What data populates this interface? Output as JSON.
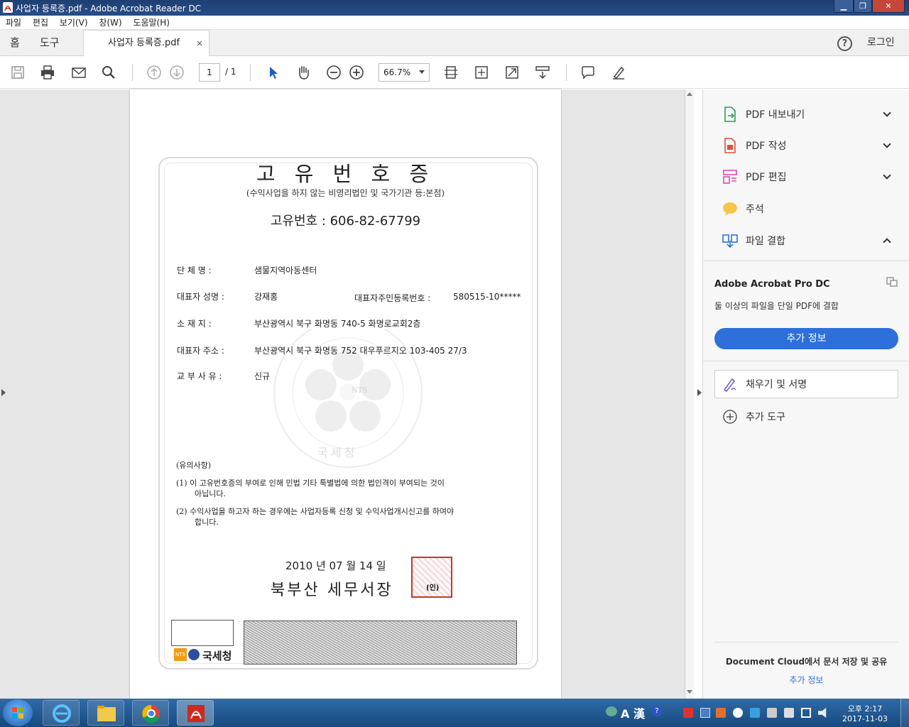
{
  "window": {
    "title": "사업자 등록증.pdf - Adobe Acrobat Reader DC",
    "minimize": "▁",
    "maximize": "❐",
    "close": "✕"
  },
  "menu": [
    "파일",
    "편집",
    "보기(V)",
    "창(W)",
    "도움말(H)"
  ],
  "tabs": {
    "home": "홈",
    "tools": "도구",
    "document": "사업자 등록증.pdf",
    "close": "×",
    "help": "?",
    "login": "로그인"
  },
  "toolbar": {
    "page_current": "1",
    "page_total": "/ 1",
    "zoom": "66.7%",
    "icons": [
      "save-icon",
      "print-icon",
      "email-icon",
      "search-icon",
      "page-up-icon",
      "page-down-icon",
      "select-arrow-icon",
      "hand-tool-icon",
      "zoom-out-icon",
      "zoom-in-icon",
      "fit-width-icon",
      "fit-page-icon",
      "fullscreen-icon",
      "scroll-mode-icon",
      "comment-icon",
      "highlight-pen-icon"
    ]
  },
  "document": {
    "title": "고 유 번 호 증",
    "subtitle": "(수익사업을 하지 않는 비영리법인 및 국가기관 등:본점)",
    "number_line": "고유번호 : 606-82-67799",
    "fields": [
      {
        "label": "단    체    명 :",
        "value": "샘물지역아동센터"
      },
      {
        "label": "대표자  성명 :",
        "value": "강재홍"
      },
      {
        "label": "소    재    지 :",
        "value": "부산광역시  북구  화명동 740-5 화명로교회2층"
      },
      {
        "label": "대표자  주소 :",
        "value": "부산광역시  북구  화명동 752  대우푸르지오  103-405 27/3"
      },
      {
        "label": "교  부  사  유 :",
        "value": "신규"
      }
    ],
    "resident_label": "대표자주민등록번호 :",
    "resident_value": "580515-10*****",
    "notes_heading": "(유의사항)",
    "note1": "(1) 이 고유번호증의 부여로 인해 민법 기타 특별법에 의한 법인격이 부여되는 것이",
    "note1b": "아닙니다.",
    "note2": "(2) 수익사업을 하고자 하는 경우에는 사업자등록 신청 및 수익사업개시신고를 하여야",
    "note2b": "합니다.",
    "date_line": "2010 년   07 월   14 일",
    "issuer": "북부산 세무서장",
    "seal_mark": "(인)",
    "agency_logo": "국세청",
    "agency_badge": "NTS",
    "watermark_agency": "국세청",
    "watermark_badge": "NTS"
  },
  "right_pane": {
    "tools": [
      {
        "label": "PDF 내보내기",
        "icon": "export-pdf-icon"
      },
      {
        "label": "PDF 작성",
        "icon": "create-pdf-icon"
      },
      {
        "label": "PDF 편집",
        "icon": "edit-pdf-icon"
      },
      {
        "label": "주석",
        "icon": "comment-bubble-icon"
      },
      {
        "label": "파일 결합",
        "icon": "combine-files-icon"
      }
    ],
    "promo_title": "Adobe Acrobat Pro DC",
    "promo_text": "둘 이상의 파일을 단일 PDF에 결합",
    "promo_button": "추가 정보",
    "fill_sign": "채우기 및 서명",
    "more_tools": "추가 도구",
    "cloud_text": "Document Cloud에서 문서 저장 및 공유",
    "cloud_link": "추가 정보"
  },
  "taskbar": {
    "ime": "A 漢",
    "time": "오후 2:17",
    "date": "2017-11-03"
  },
  "colors": {
    "titlebar": "#274d86",
    "accent_blue": "#2d6fdb",
    "taskbar": "#174a7e",
    "seal_red": "#c0392b"
  }
}
